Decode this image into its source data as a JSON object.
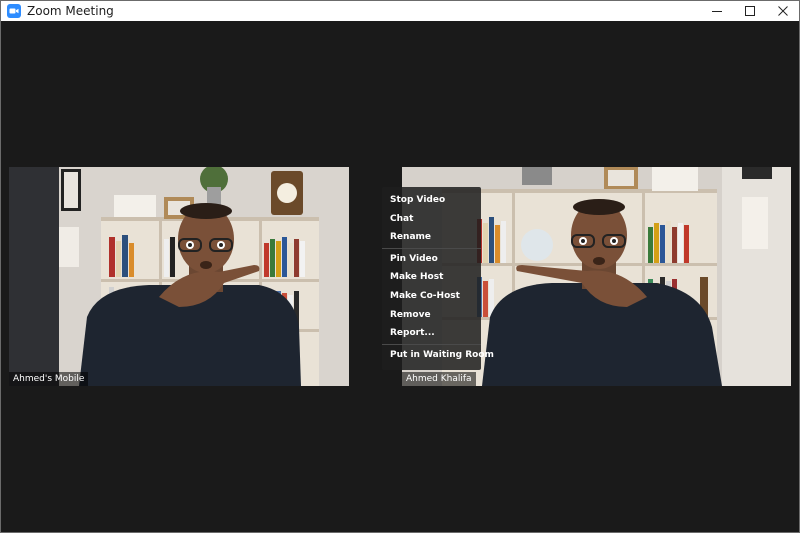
{
  "window": {
    "title": "Zoom Meeting",
    "icon": "zoom-camera-icon",
    "controls": [
      "minimize-icon",
      "maximize-icon",
      "close-icon"
    ]
  },
  "participants": [
    {
      "name": "Ahmed's Mobile"
    },
    {
      "name": "Ahmed Khalifa"
    }
  ],
  "context_menu": {
    "items": [
      {
        "label": "Stop Video"
      },
      {
        "label": "Chat"
      },
      {
        "label": "Rename"
      },
      {
        "label": "Pin Video"
      },
      {
        "label": "Make Host"
      },
      {
        "label": "Make Co-Host"
      },
      {
        "label": "Remove"
      },
      {
        "label": "Report..."
      },
      {
        "label": "Put in Waiting Room"
      }
    ]
  },
  "colors": {
    "zoom_blue": "#2d8cff",
    "meeting_bg": "#1a1a1a",
    "menu_bg": "#1e1e1e"
  }
}
